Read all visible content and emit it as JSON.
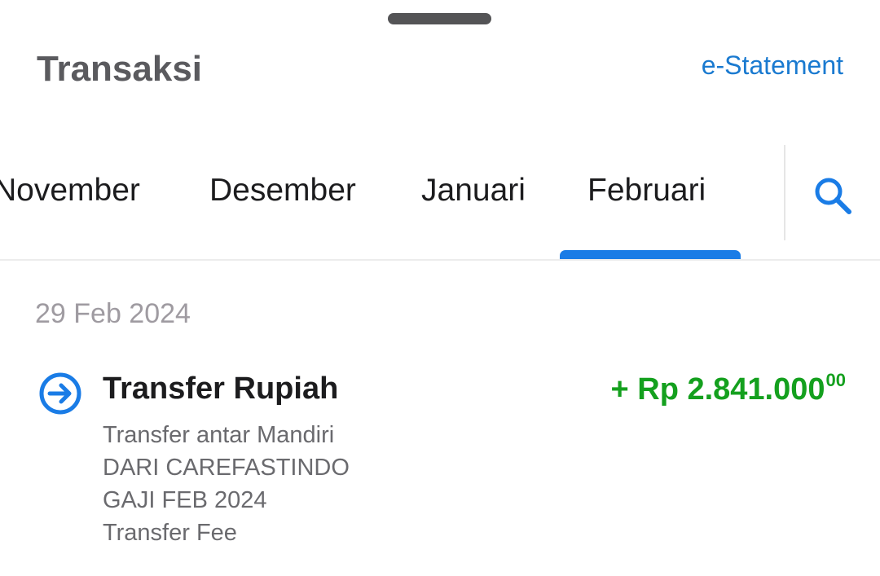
{
  "header": {
    "title": "Transaksi",
    "estatement_label": "e-Statement"
  },
  "tabs": [
    {
      "label": "November",
      "selected": false
    },
    {
      "label": "Desember",
      "selected": false
    },
    {
      "label": "Januari",
      "selected": false
    },
    {
      "label": "Februari",
      "selected": true
    }
  ],
  "search": {
    "icon": "search-icon"
  },
  "transactions": {
    "date": "29 Feb 2024",
    "items": [
      {
        "icon": "transfer-in-icon",
        "title": "Transfer Rupiah",
        "amount_main": "+ Rp 2.841.000",
        "amount_cents": "00",
        "description": [
          "Transfer antar Mandiri",
          "DARI CAREFASTINDO",
          "GAJI FEB 2024",
          "Transfer Fee"
        ]
      }
    ]
  },
  "colors": {
    "accent": "#1a7ce6",
    "link": "#1a7ad0",
    "credit": "#14a01e"
  }
}
